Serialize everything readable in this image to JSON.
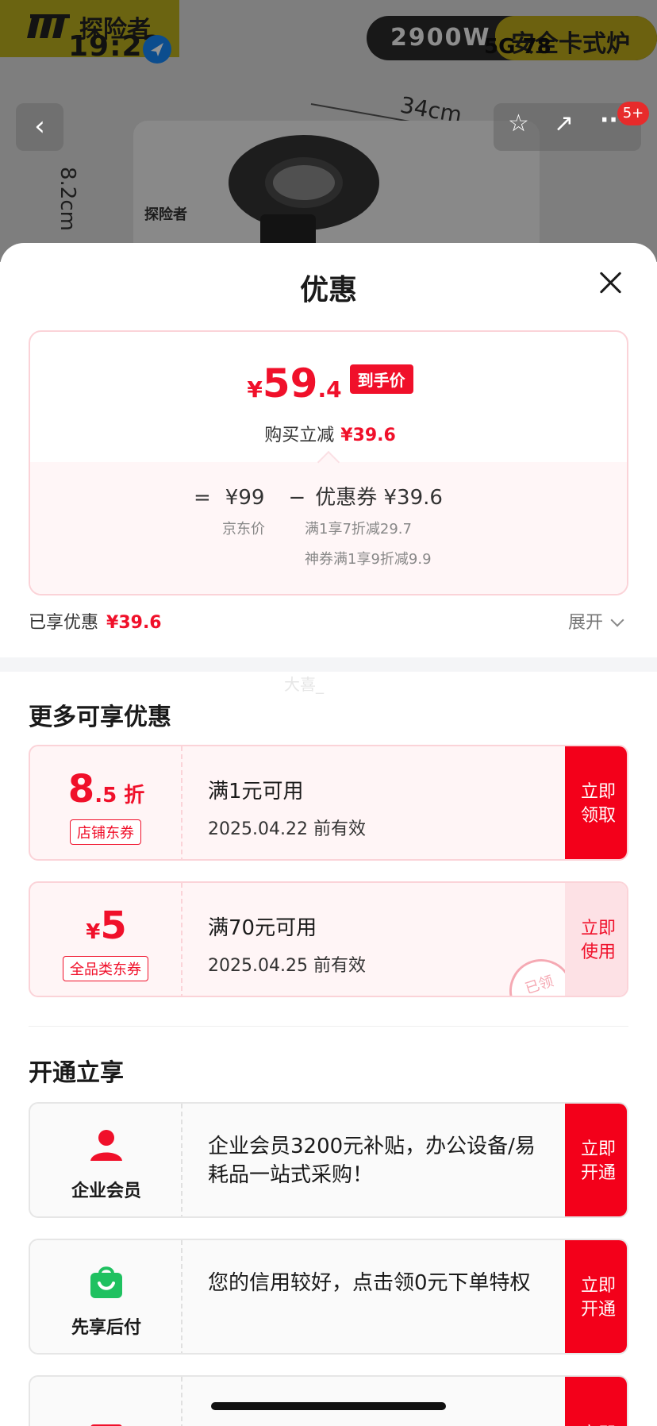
{
  "background": {
    "brand_name": "探险者",
    "status_time": "19:22",
    "promo_power": "2900W",
    "promo_text": "安全卡式炉",
    "status_right": "5G 78",
    "dimension_width": "34cm",
    "dimension_height": "8.2cm",
    "badge": "5+",
    "nav_back": "‹",
    "nav_star": "☆",
    "nav_share": "↗",
    "nav_more": "···"
  },
  "sheet": {
    "title": "优惠",
    "price": {
      "yen": "¥",
      "int": "59",
      "dec": ".4",
      "tag": "到手价",
      "discount_label": "购买立减",
      "discount_value": "¥39.6"
    },
    "formula": {
      "eq": "=",
      "jd_price": "¥99",
      "minus": "−",
      "coupon": "优惠券 ¥39.6",
      "jd_price_label": "京东价",
      "rule1": "满1享7折减29.7",
      "rule2": "神券满1享9折减9.9"
    },
    "enjoyed_label": "已享优惠",
    "enjoyed_value": "¥39.6",
    "expand_label": "展开",
    "watermark": "大喜_"
  },
  "more_offers": {
    "title": "更多可享优惠",
    "coupons": [
      {
        "amount_big": "8",
        "amount_small": ".5 折",
        "type": "店铺东券",
        "condition": "满1元可用",
        "valid": "2025.04.22 前有效",
        "action": "立即领取"
      },
      {
        "amount_prefix": "¥",
        "amount_big": "5",
        "type": "全品类东券",
        "condition": "满70元可用",
        "valid": "2025.04.25 前有效",
        "action": "立即使用",
        "stamp": "已领"
      }
    ]
  },
  "open_section": {
    "title": "开通立享",
    "items": [
      {
        "label": "企业会员",
        "icon": "person-icon",
        "desc": "企业会员3200元补贴，办公设备/易耗品一站式采购！",
        "action": "立即开通"
      },
      {
        "label": "先享后付",
        "icon": "shopping-bag-icon",
        "desc": "您的信用较好，点击领0元下单特权",
        "action": "立即开通"
      },
      {
        "label": "",
        "icon": "card-icon",
        "desc": "",
        "action": "立即"
      }
    ]
  },
  "colors": {
    "accent_red": "#f0102a",
    "button_red": "#f3001a",
    "green_icon": "#1fc160"
  }
}
